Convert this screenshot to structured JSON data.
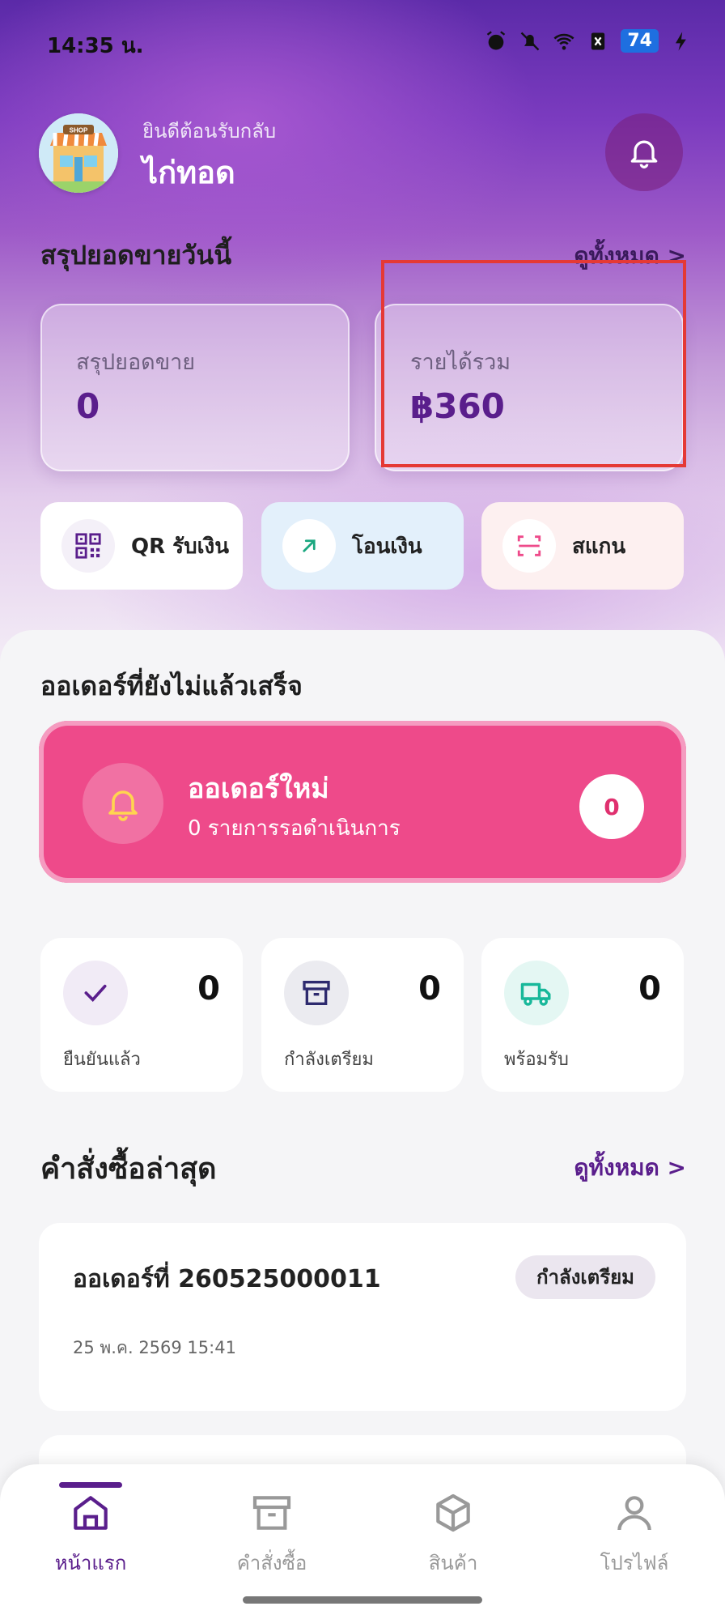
{
  "status_bar": {
    "time": "14:35 น.",
    "battery": "74"
  },
  "header": {
    "welcome": "ยินดีต้อนรับกลับ",
    "shop_name": "ไก่ทอด",
    "avatar_sign": "SHOP"
  },
  "today_summary": {
    "title": "สรุปยอดขายวันนี้",
    "view_all": "ดูทั้งหมด >",
    "cards": [
      {
        "label": "สรุปยอดขาย",
        "value": "0"
      },
      {
        "label": "รายได้รวม",
        "value": "฿360"
      }
    ]
  },
  "quick_actions": [
    {
      "label": "QR รับเงิน",
      "icon": "qr-code-icon"
    },
    {
      "label": "โอนเงิน",
      "icon": "arrow-up-right-icon"
    },
    {
      "label": "สแกน",
      "icon": "scan-icon"
    }
  ],
  "pending": {
    "title": "ออเดอร์ที่ยังไม่แล้วเสร็จ",
    "new_order_title": "ออเดอร์ใหม่",
    "new_order_subtitle": "0 รายการรอดำเนินการ",
    "new_order_count": "0"
  },
  "stats": [
    {
      "label": "ยืนยันแล้ว",
      "value": "0",
      "icon": "check-icon",
      "color": "#5a1e8c"
    },
    {
      "label": "กำลังเตรียม",
      "value": "0",
      "icon": "archive-box-icon",
      "color": "#2d2a6e"
    },
    {
      "label": "พร้อมรับ",
      "value": "0",
      "icon": "truck-icon",
      "color": "#18b89a"
    }
  ],
  "recent_orders": {
    "title": "คำสั่งซื้อล่าสุด",
    "view_all": "ดูทั้งหมด >",
    "orders": [
      {
        "id": "ออเดอร์ที่ 260525000011",
        "status": "กำลังเตรียม",
        "datetime": "25 พ.ค. 2569 15:41"
      }
    ]
  },
  "nav": [
    {
      "label": "หน้าแรก",
      "icon": "home-icon",
      "active": true
    },
    {
      "label": "คำสั่งซื้อ",
      "icon": "archive-box-icon",
      "active": false
    },
    {
      "label": "สินค้า",
      "icon": "cube-icon",
      "active": false
    },
    {
      "label": "โปรไฟล์",
      "icon": "user-icon",
      "active": false
    }
  ],
  "colors": {
    "accent": "#5a1e8c",
    "new_order": "#ee4a8a",
    "highlight": "#e53935"
  }
}
